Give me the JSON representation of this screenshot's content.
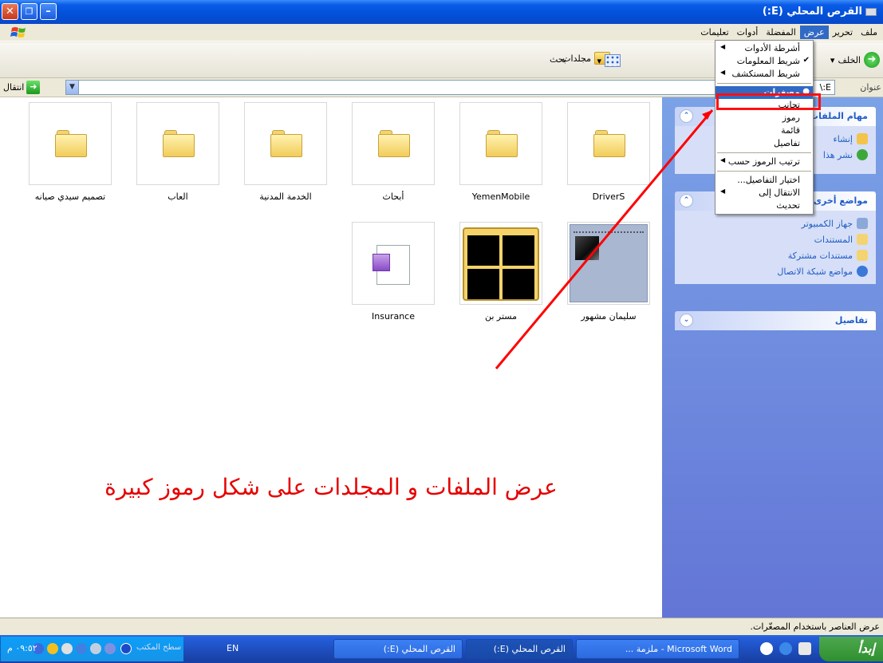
{
  "window": {
    "title": "القرص المحلي (E:)"
  },
  "menubar": [
    "ملف",
    "تحرير",
    "عرض",
    "المفضلة",
    "أدوات",
    "تعليمات"
  ],
  "toolbar": {
    "back": "الخلف",
    "folders": "مجلدات",
    "search": "بحث"
  },
  "address": {
    "label": "عنوان",
    "value": "E:\\",
    "go": "انتقال"
  },
  "view_menu": {
    "items": [
      {
        "label": "أشرطة الأدوات",
        "sub": true
      },
      {
        "label": "شريط المعلومات",
        "check": true
      },
      {
        "label": "شريط المستكشف",
        "sub": true
      },
      {
        "sep": true
      },
      {
        "label": "مصغرات",
        "selected": true
      },
      {
        "label": "تجانب"
      },
      {
        "label": "رموز"
      },
      {
        "label": "قائمة"
      },
      {
        "label": "تفاصيل"
      },
      {
        "sep": true
      },
      {
        "label": "ترتيب الرموز حسب",
        "sub": true
      },
      {
        "sep": true
      },
      {
        "label": "اختيار التفاصيل..."
      },
      {
        "label": "الانتقال إلى",
        "sub": true
      },
      {
        "label": "تحديث"
      }
    ]
  },
  "files": [
    {
      "name": "تصميم سيدي صيانه",
      "kind": "folder"
    },
    {
      "name": "العاب",
      "kind": "folder"
    },
    {
      "name": "الخدمة المدنية",
      "kind": "folder"
    },
    {
      "name": "أبحاث",
      "kind": "folder"
    },
    {
      "name": "YemenMobile",
      "kind": "folder"
    },
    {
      "name": "DriverS",
      "kind": "folder"
    },
    {
      "name": "Insurance",
      "kind": "document"
    },
    {
      "name": "مستر بن",
      "kind": "image-folder"
    },
    {
      "name": "سليمان مشهور",
      "kind": "notebook"
    }
  ],
  "annotation": "عرض الملفات و المجلدات على شكل رموز كبيرة",
  "taskpane": {
    "file_tasks": {
      "title": "مهام الملفات",
      "items": [
        "إنشاء",
        "نشر هذا"
      ]
    },
    "other_places": {
      "title": "مواضع أخرى",
      "items": [
        "جهاز الكمبيوتر",
        "المستندات",
        "مستندات مشتركة",
        "مواضع شبكة الاتصال"
      ]
    },
    "details": {
      "title": "تفاصيل"
    }
  },
  "statusbar": "عرض العناصر باستخدام المصغّرات.",
  "taskbar": {
    "start": "إبدأ",
    "tasks": [
      "Microsoft Word - ملزمة ...",
      "القرص المحلي (E:)",
      "القرص المحلي (E:)"
    ],
    "desktop": "سطح المكتب",
    "lang": "EN",
    "clock": "٠٩:٥٢ م"
  },
  "colors": {
    "xp_blue": "#0a5ce8",
    "menu_highlight": "#316ac5",
    "annotation_red": "#e60000"
  }
}
